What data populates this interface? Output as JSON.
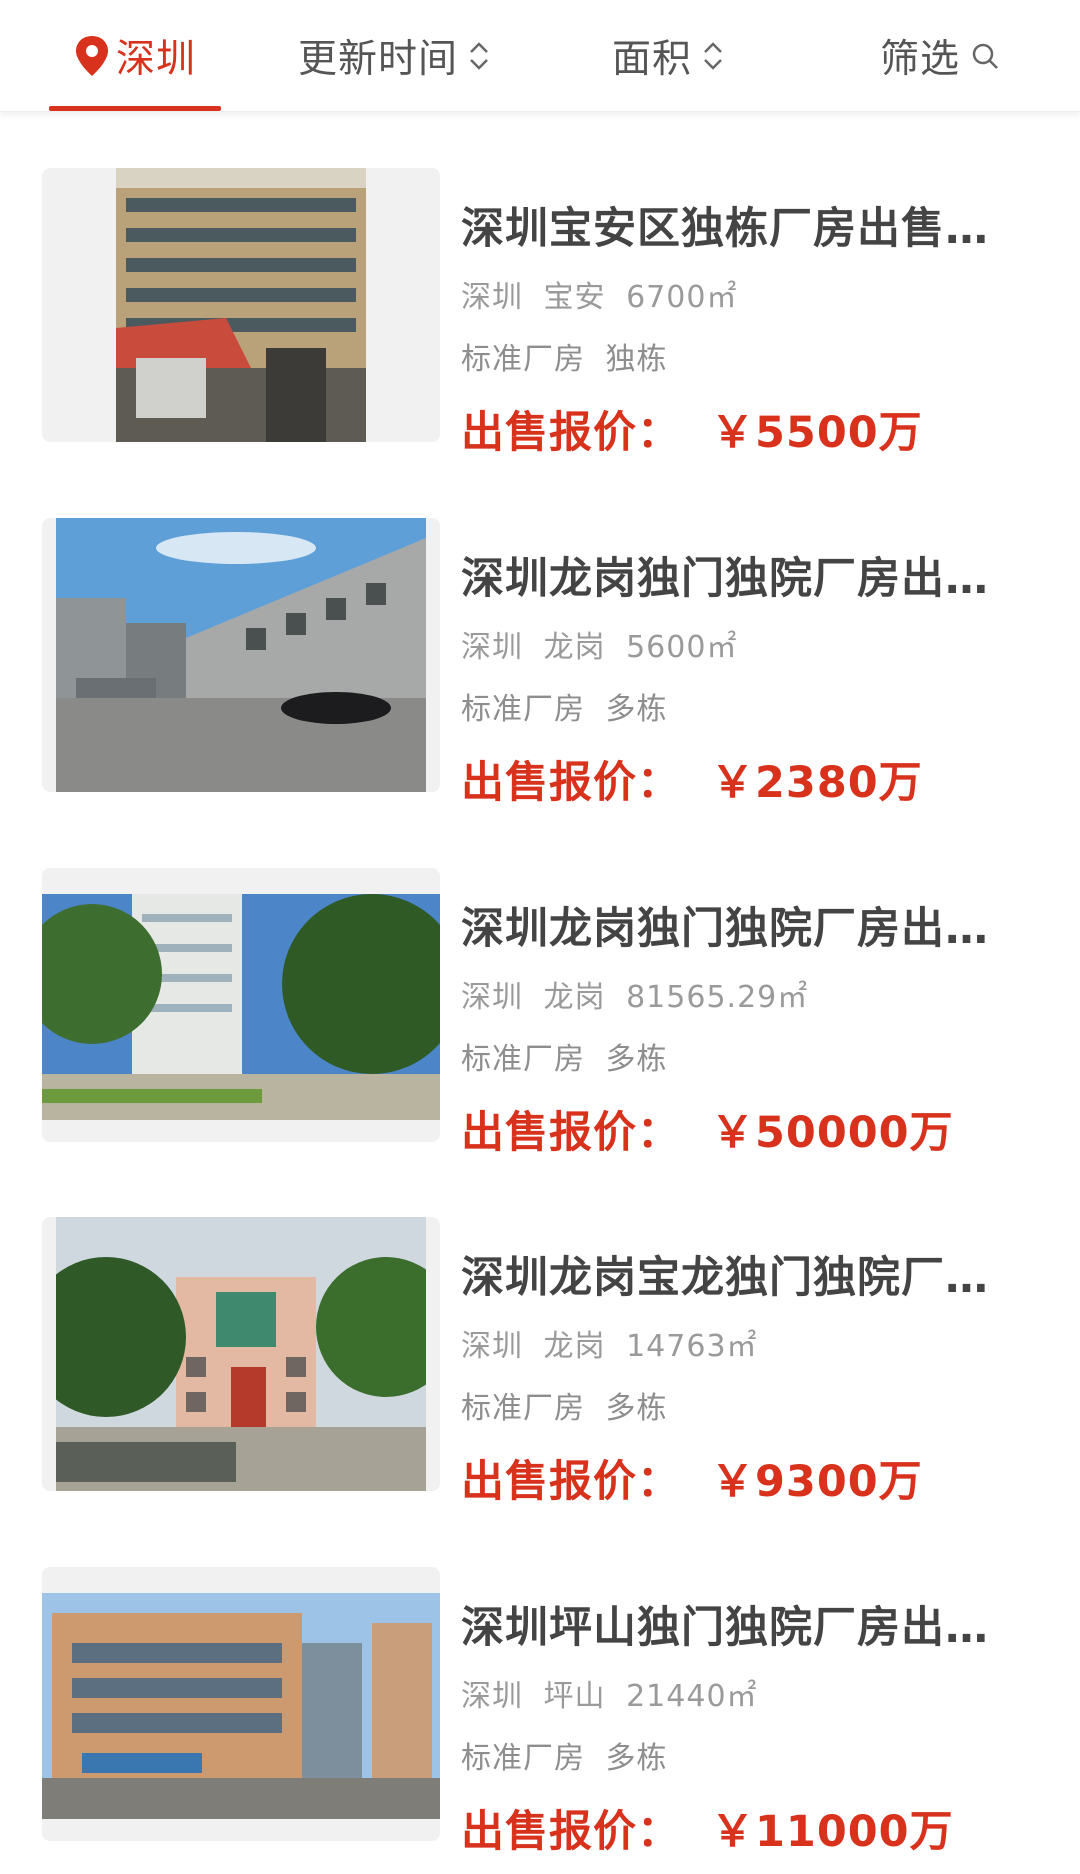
{
  "header": {
    "tabs": [
      {
        "label": "深圳",
        "icon": "location-pin-icon"
      },
      {
        "label": "更新时间",
        "icon": "sort-icon"
      },
      {
        "label": "面积",
        "icon": "sort-icon"
      },
      {
        "label": "筛选",
        "icon": "search-icon"
      }
    ],
    "active_color": "#d8311c"
  },
  "listings": [
    {
      "title": "深圳宝安区独栋厂房出售…",
      "city": "深圳",
      "district": "宝安",
      "area": "6700㎡",
      "tags": [
        "标准厂房",
        "独栋"
      ],
      "price_label": "出售报价：",
      "price": "￥5500万"
    },
    {
      "title": "深圳龙岗独门独院厂房出…",
      "city": "深圳",
      "district": "龙岗",
      "area": "5600㎡",
      "tags": [
        "标准厂房",
        "多栋"
      ],
      "price_label": "出售报价：",
      "price": "￥2380万"
    },
    {
      "title": "深圳龙岗独门独院厂房出…",
      "city": "深圳",
      "district": "龙岗",
      "area": "81565.29㎡",
      "tags": [
        "标准厂房",
        "多栋"
      ],
      "price_label": "出售报价：",
      "price": "￥50000万"
    },
    {
      "title": "深圳龙岗宝龙独门独院厂…",
      "city": "深圳",
      "district": "龙岗",
      "area": "14763㎡",
      "tags": [
        "标准厂房",
        "多栋"
      ],
      "price_label": "出售报价：",
      "price": "￥9300万"
    },
    {
      "title": "深圳坪山独门独院厂房出…",
      "city": "深圳",
      "district": "坪山",
      "area": "21440㎡",
      "tags": [
        "标准厂房",
        "多栋"
      ],
      "price_label": "出售报价：",
      "price": "￥11000万"
    }
  ]
}
